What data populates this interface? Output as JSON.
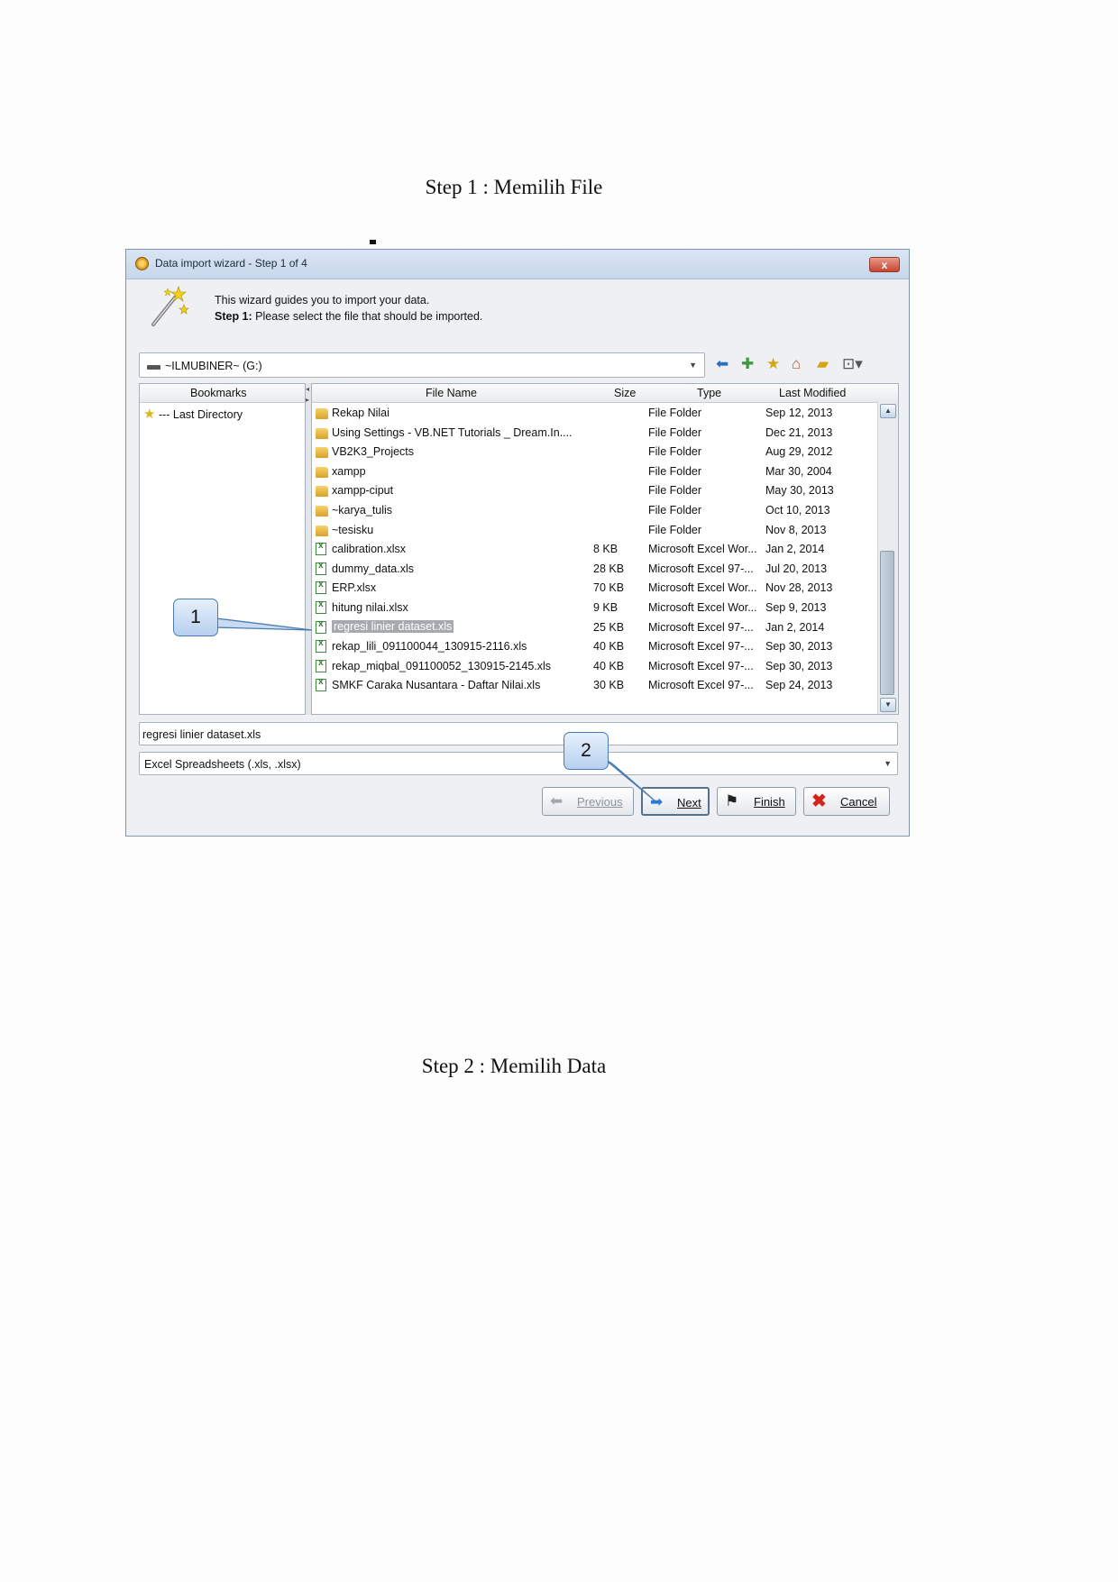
{
  "captions": {
    "step1": "Step 1 : Memilih File",
    "step2": "Step 2 : Memilih Data"
  },
  "dialog": {
    "title": "Data import wizard - Step 1 of 4",
    "close_symbol": "x",
    "intro_line1": "This wizard guides you to import your data.",
    "intro_step_label": "Step 1:",
    "intro_step_text": " Please select the file that should be imported.",
    "path": "~ILMUBINER~ (G:)",
    "bookmarks": {
      "header": "Bookmarks",
      "items": [
        "--- Last Directory"
      ]
    },
    "columns": [
      "File Name",
      "Size",
      "Type",
      "Last Modified"
    ],
    "files": [
      {
        "icon": "folder",
        "name": "Rekap Nilai",
        "size": "",
        "type": "File Folder",
        "modified": "Sep 12, 2013"
      },
      {
        "icon": "folder",
        "name": "Using Settings - VB.NET Tutorials _ Dream.In....",
        "size": "",
        "type": "File Folder",
        "modified": "Dec 21, 2013"
      },
      {
        "icon": "folder",
        "name": "VB2K3_Projects",
        "size": "",
        "type": "File Folder",
        "modified": "Aug 29, 2012"
      },
      {
        "icon": "folder",
        "name": "xampp",
        "size": "",
        "type": "File Folder",
        "modified": "Mar 30, 2004"
      },
      {
        "icon": "folder",
        "name": "xampp-ciput",
        "size": "",
        "type": "File Folder",
        "modified": "May 30, 2013"
      },
      {
        "icon": "folder",
        "name": "~karya_tulis",
        "size": "",
        "type": "File Folder",
        "modified": "Oct 10, 2013"
      },
      {
        "icon": "folder",
        "name": "~tesisku",
        "size": "",
        "type": "File Folder",
        "modified": "Nov 8, 2013"
      },
      {
        "icon": "xlsx",
        "name": "calibration.xlsx",
        "size": "8 KB",
        "type": "Microsoft Excel Wor...",
        "modified": "Jan 2, 2014"
      },
      {
        "icon": "xls",
        "name": "dummy_data.xls",
        "size": "28 KB",
        "type": "Microsoft Excel 97-...",
        "modified": "Jul 20, 2013"
      },
      {
        "icon": "xlsx",
        "name": "ERP.xlsx",
        "size": "70 KB",
        "type": "Microsoft Excel Wor...",
        "modified": "Nov 28, 2013"
      },
      {
        "icon": "xlsx",
        "name": "hitung nilai.xlsx",
        "size": "9 KB",
        "type": "Microsoft Excel Wor...",
        "modified": "Sep 9, 2013"
      },
      {
        "icon": "xls",
        "name": "regresi linier dataset.xls",
        "size": "25 KB",
        "type": "Microsoft Excel 97-...",
        "modified": "Jan 2, 2014",
        "selected": true
      },
      {
        "icon": "xls",
        "name": "rekap_lili_091100044_130915-2116.xls",
        "size": "40 KB",
        "type": "Microsoft Excel 97-...",
        "modified": "Sep 30, 2013"
      },
      {
        "icon": "xls",
        "name": "rekap_miqbal_091100052_130915-2145.xls",
        "size": "40 KB",
        "type": "Microsoft Excel 97-...",
        "modified": "Sep 30, 2013"
      },
      {
        "icon": "xls",
        "name": "SMKF Caraka Nusantara - Daftar Nilai.xls",
        "size": "30 KB",
        "type": "Microsoft Excel 97-...",
        "modified": "Sep 24, 2013"
      }
    ],
    "file_name_value": "regresi linier dataset.xls",
    "file_filter": "Excel Spreadsheets (.xls, .xlsx)",
    "buttons": {
      "previous": "Previous",
      "next": "Next",
      "finish": "Finish",
      "cancel": "Cancel"
    }
  },
  "callouts": {
    "one": "1",
    "two": "2"
  },
  "colors": {
    "selection": "#a6a9ad",
    "callout_border": "#4b7bb0",
    "folder": "#e6b940"
  }
}
